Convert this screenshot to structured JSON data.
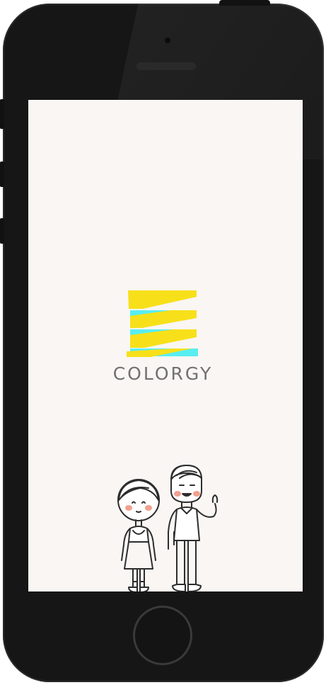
{
  "app": {
    "brand_name": "COLORGY"
  },
  "colors": {
    "logo_yellow": "#f7e01a",
    "logo_cyan": "#58eef0",
    "brand_text": "#707070",
    "screen_bg": "#f9f6f4",
    "phone_body": "#161616"
  },
  "icons": {
    "logo": "colorgy-logo-icon",
    "illustration": "couple-illustration",
    "home": "home-button"
  }
}
